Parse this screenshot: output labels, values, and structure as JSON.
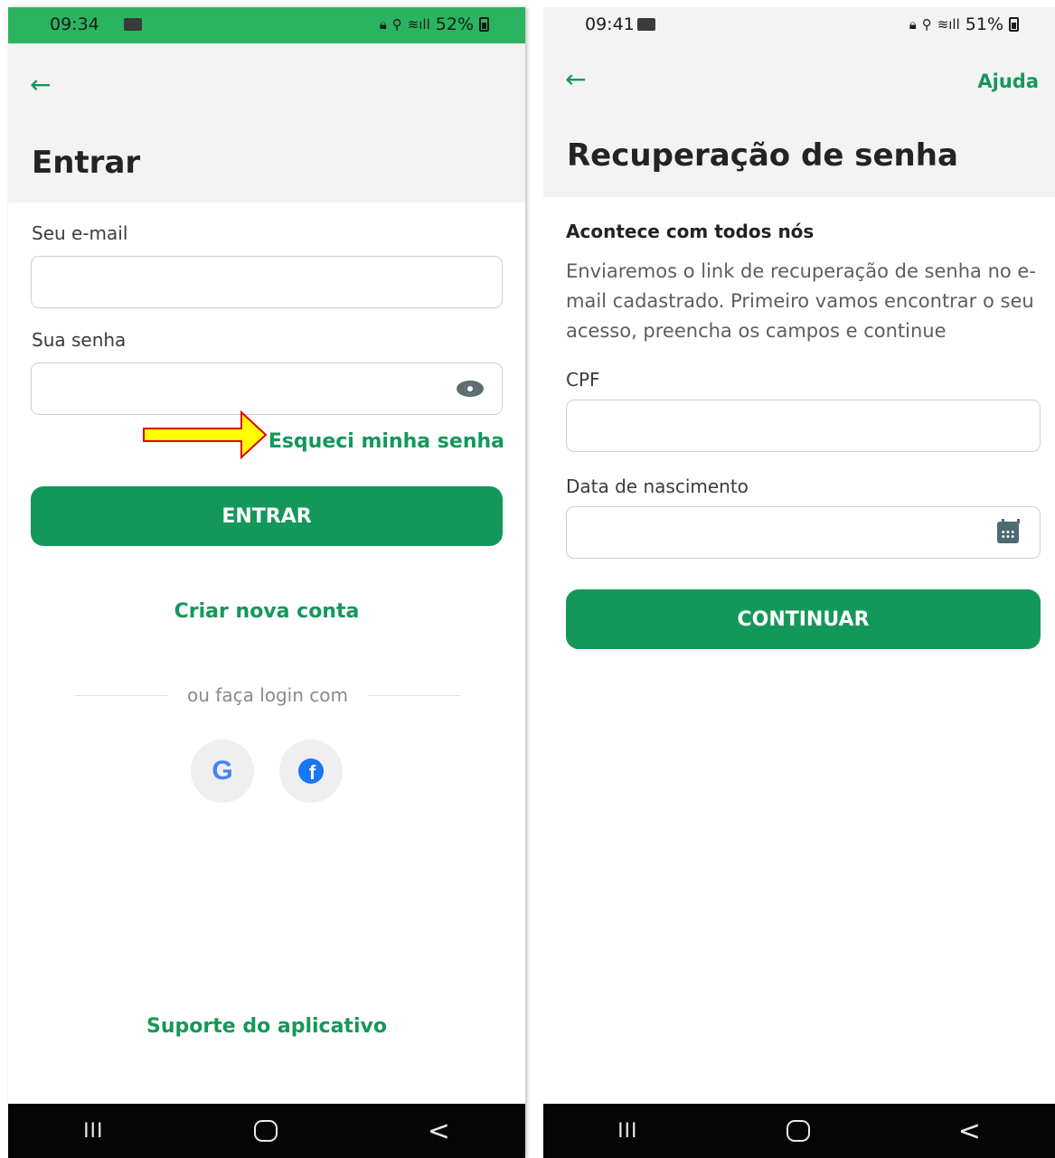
{
  "left_screen": {
    "status": {
      "time": "09:34",
      "battery": "52%"
    },
    "title": "Entrar",
    "email_label": "Seu e-mail",
    "email_value": "",
    "password_label": "Sua senha",
    "password_value": "",
    "forgot_link": "Esqueci minha senha",
    "login_button": "ENTRAR",
    "create_account_link": "Criar nova conta",
    "divider_text": "ou faça login com",
    "social": [
      {
        "name": "google",
        "glyph": "G"
      },
      {
        "name": "facebook",
        "glyph": "f"
      }
    ],
    "support_link": "Suporte do aplicativo"
  },
  "right_screen": {
    "status": {
      "time": "09:41",
      "battery": "51%"
    },
    "help_link": "Ajuda",
    "title": "Recuperação de senha",
    "subheading": "Acontece com todos nós",
    "description": "Enviaremos o link de recuperação de senha no e-mail cadastrado. Primeiro vamos encontrar o seu acesso, preencha os campos e continue",
    "cpf_label": "CPF",
    "cpf_value": "",
    "birthdate_label": "Data de nascimento",
    "birthdate_value": "",
    "continue_button": "CONTINUAR"
  },
  "navbar": {
    "recent": "III",
    "back": "<"
  },
  "icons": {
    "back": "arrow-left-icon",
    "password_toggle": "eye-icon",
    "date": "calendar-icon"
  },
  "colors": {
    "brand_green": "#14985a",
    "status_green": "#2bb45f",
    "annotation_arrow_fill": "#ffff00",
    "annotation_arrow_stroke": "#e00000"
  }
}
